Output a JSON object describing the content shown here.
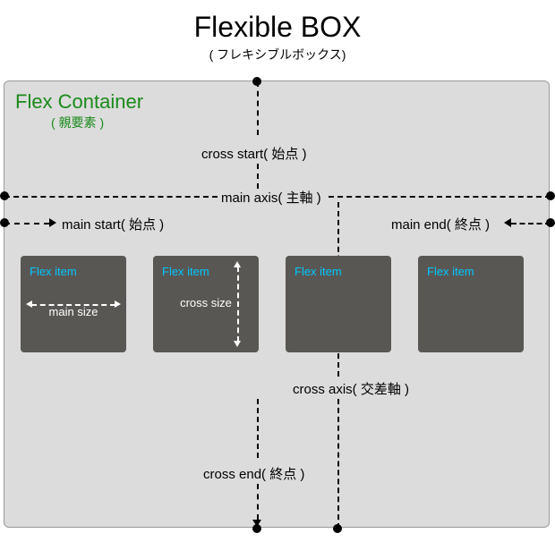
{
  "title": "Flexible BOX",
  "subtitle": "( フレキシブルボックス)",
  "container": {
    "title": "Flex Container",
    "subtitle": "( 親要素 )"
  },
  "axes": {
    "main_axis": "main axis( 主軸 )",
    "cross_axis": "cross axis( 交差軸 )",
    "main_start": "main start( 始点 )",
    "main_end": "main end( 終点 )",
    "cross_start": "cross start( 始点 )",
    "cross_end": "cross end( 終点 )"
  },
  "items": [
    {
      "label": "Flex item",
      "dim": "main size"
    },
    {
      "label": "Flex item",
      "dim": "cross size"
    },
    {
      "label": "Flex item"
    },
    {
      "label": "Flex item"
    }
  ]
}
